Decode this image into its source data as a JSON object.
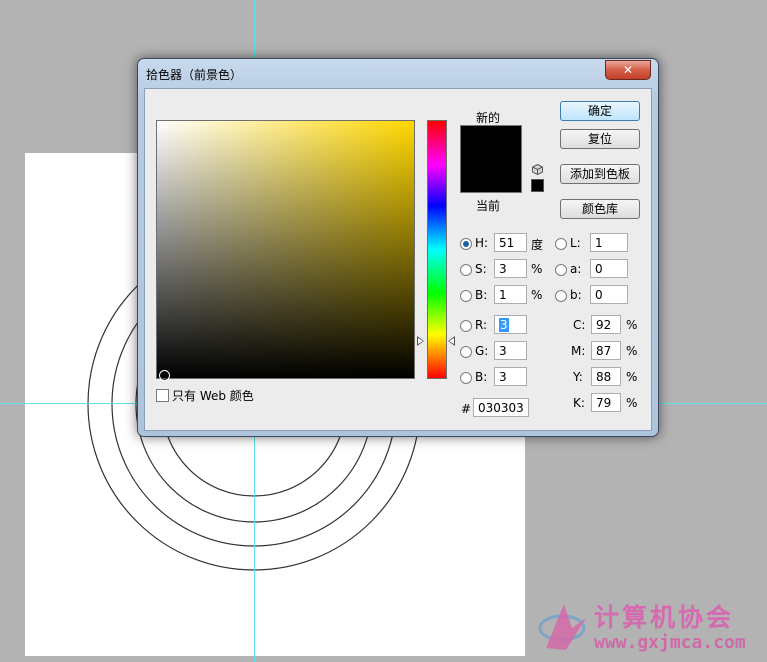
{
  "dialog": {
    "title": "拾色器（前景色）",
    "close_glyph": "✕",
    "web_only_label": "只有 Web 颜色",
    "new_label": "新的",
    "current_label": "当前",
    "new_color": "#000000",
    "buttons": {
      "ok": "确定",
      "reset": "复位",
      "add_swatch": "添加到色板",
      "libraries": "颜色库"
    },
    "hsb": {
      "h": {
        "label": "H:",
        "value": "51",
        "unit": "度"
      },
      "s": {
        "label": "S:",
        "value": "3",
        "unit": "%"
      },
      "b": {
        "label": "B:",
        "value": "1",
        "unit": "%"
      }
    },
    "rgb": {
      "r": {
        "label": "R:",
        "value": "3"
      },
      "g": {
        "label": "G:",
        "value": "3"
      },
      "b": {
        "label": "B:",
        "value": "3"
      }
    },
    "lab": {
      "l": {
        "label": "L:",
        "value": "1"
      },
      "a": {
        "label": "a:",
        "value": "0"
      },
      "b": {
        "label": "b:",
        "value": "0"
      }
    },
    "cmyk": {
      "c": {
        "label": "C:",
        "value": "92",
        "unit": "%"
      },
      "m": {
        "label": "M:",
        "value": "87",
        "unit": "%"
      },
      "y": {
        "label": "Y:",
        "value": "88",
        "unit": "%"
      },
      "k": {
        "label": "K:",
        "value": "79",
        "unit": "%"
      }
    },
    "hex": {
      "label": "#",
      "value": "030303"
    }
  },
  "watermark": {
    "title": "计算机协会",
    "url": "www.gxjmca.com"
  }
}
